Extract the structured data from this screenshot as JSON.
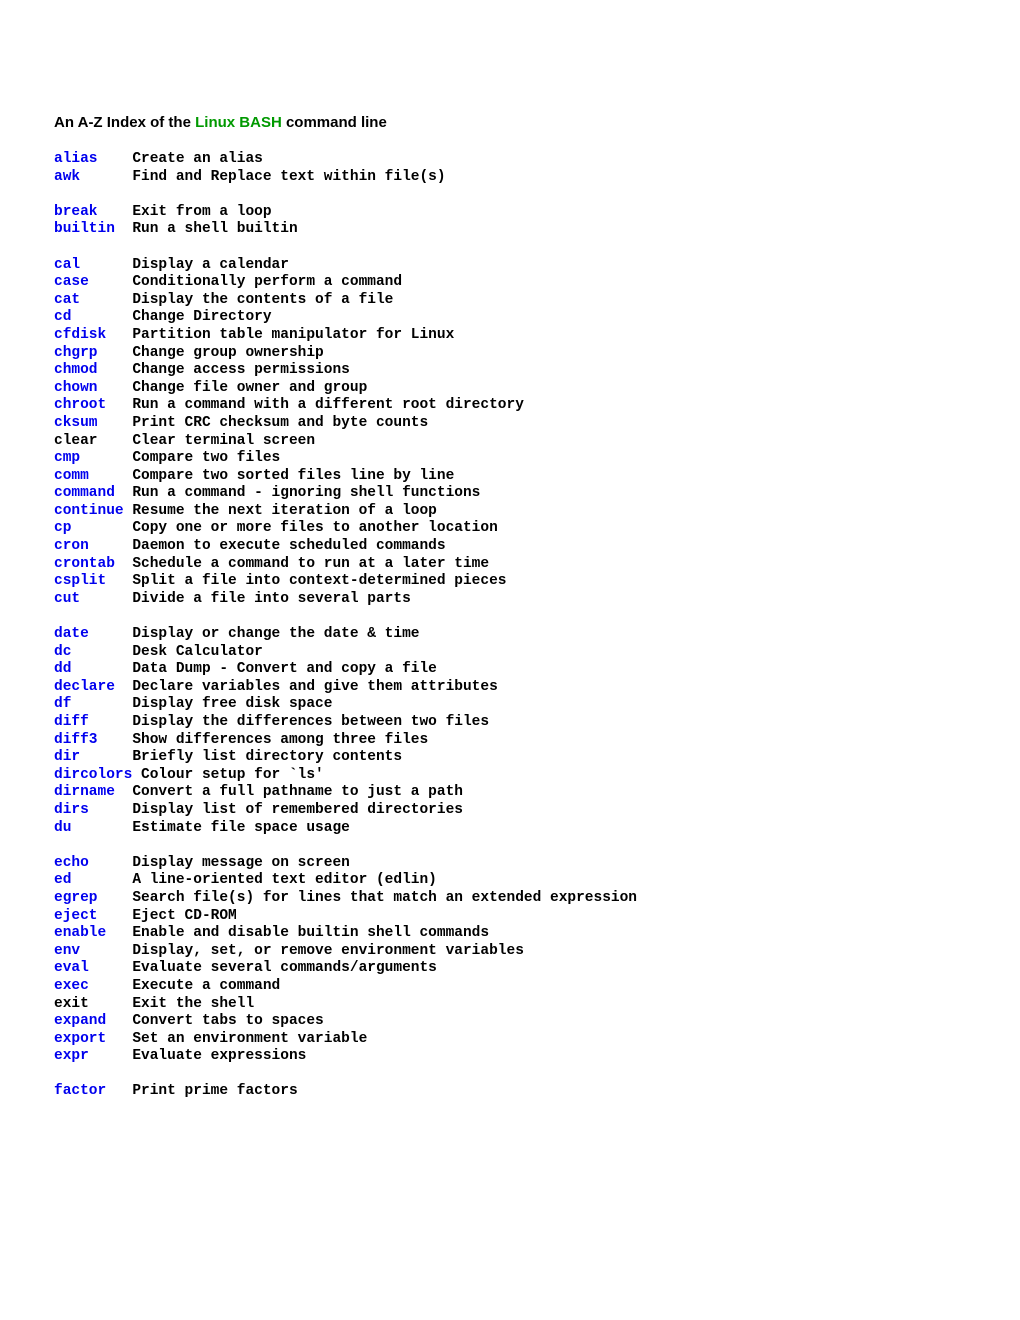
{
  "heading": {
    "prefix": "An A-Z Index of the ",
    "link": "Linux BASH",
    "suffix": " command line"
  },
  "commands": [
    {
      "name": "alias",
      "link": true,
      "desc": "Create an alias"
    },
    {
      "name": "awk",
      "link": true,
      "desc": "Find and Replace text within file(s)"
    },
    {
      "blank": true
    },
    {
      "name": "break",
      "link": true,
      "desc": "Exit from a loop"
    },
    {
      "name": "builtin",
      "link": true,
      "desc": "Run a shell builtin"
    },
    {
      "blank": true
    },
    {
      "name": "cal",
      "link": true,
      "desc": "Display a calendar"
    },
    {
      "name": "case",
      "link": true,
      "desc": "Conditionally perform a command"
    },
    {
      "name": "cat",
      "link": true,
      "desc": "Display the contents of a file"
    },
    {
      "name": "cd",
      "link": true,
      "desc": "Change Directory"
    },
    {
      "name": "cfdisk",
      "link": true,
      "desc": "Partition table manipulator for Linux"
    },
    {
      "name": "chgrp",
      "link": true,
      "desc": "Change group ownership"
    },
    {
      "name": "chmod",
      "link": true,
      "desc": "Change access permissions"
    },
    {
      "name": "chown",
      "link": true,
      "desc": "Change file owner and group"
    },
    {
      "name": "chroot",
      "link": true,
      "desc": "Run a command with a different root directory"
    },
    {
      "name": "cksum",
      "link": true,
      "desc": "Print CRC checksum and byte counts"
    },
    {
      "name": "clear",
      "link": false,
      "desc": "Clear terminal screen"
    },
    {
      "name": "cmp",
      "link": true,
      "desc": "Compare two files"
    },
    {
      "name": "comm",
      "link": true,
      "desc": "Compare two sorted files line by line"
    },
    {
      "name": "command",
      "link": true,
      "desc": "Run a command - ignoring shell functions"
    },
    {
      "name": "continue",
      "link": true,
      "desc": "Resume the next iteration of a loop"
    },
    {
      "name": "cp",
      "link": true,
      "desc": "Copy one or more files to another location"
    },
    {
      "name": "cron",
      "link": true,
      "desc": "Daemon to execute scheduled commands"
    },
    {
      "name": "crontab",
      "link": true,
      "desc": "Schedule a command to run at a later time"
    },
    {
      "name": "csplit",
      "link": true,
      "desc": "Split a file into context-determined pieces"
    },
    {
      "name": "cut",
      "link": true,
      "desc": "Divide a file into several parts"
    },
    {
      "blank": true
    },
    {
      "name": "date",
      "link": true,
      "desc": "Display or change the date & time"
    },
    {
      "name": "dc",
      "link": true,
      "desc": "Desk Calculator"
    },
    {
      "name": "dd",
      "link": true,
      "desc": "Data Dump - Convert and copy a file"
    },
    {
      "name": "declare",
      "link": true,
      "desc": "Declare variables and give them attributes"
    },
    {
      "name": "df",
      "link": true,
      "desc": "Display free disk space"
    },
    {
      "name": "diff",
      "link": true,
      "desc": "Display the differences between two files"
    },
    {
      "name": "diff3",
      "link": true,
      "desc": "Show differences among three files"
    },
    {
      "name": "dir",
      "link": true,
      "desc": "Briefly list directory contents"
    },
    {
      "name": "dircolors",
      "link": true,
      "desc": "Colour setup for `ls'",
      "nopad": true
    },
    {
      "name": "dirname",
      "link": true,
      "desc": "Convert a full pathname to just a path"
    },
    {
      "name": "dirs",
      "link": true,
      "desc": "Display list of remembered directories"
    },
    {
      "name": "du",
      "link": true,
      "desc": "Estimate file space usage"
    },
    {
      "blank": true
    },
    {
      "name": "echo",
      "link": true,
      "desc": "Display message on screen"
    },
    {
      "name": "ed",
      "link": true,
      "desc": "A line-oriented text editor (edlin)"
    },
    {
      "name": "egrep",
      "link": true,
      "desc": "Search file(s) for lines that match an extended expression"
    },
    {
      "name": "eject",
      "link": true,
      "desc": "Eject CD-ROM"
    },
    {
      "name": "enable",
      "link": true,
      "desc": "Enable and disable builtin shell commands"
    },
    {
      "name": "env",
      "link": true,
      "desc": "Display, set, or remove environment variables"
    },
    {
      "name": "eval",
      "link": true,
      "desc": "Evaluate several commands/arguments"
    },
    {
      "name": "exec",
      "link": true,
      "desc": "Execute a command"
    },
    {
      "name": "exit",
      "link": false,
      "desc": "Exit the shell"
    },
    {
      "name": "expand",
      "link": true,
      "desc": "Convert tabs to spaces"
    },
    {
      "name": "export",
      "link": true,
      "desc": "Set an environment variable"
    },
    {
      "name": "expr",
      "link": true,
      "desc": "Evaluate expressions"
    },
    {
      "blank": true
    },
    {
      "name": "factor",
      "link": true,
      "desc": "Print prime factors"
    }
  ]
}
